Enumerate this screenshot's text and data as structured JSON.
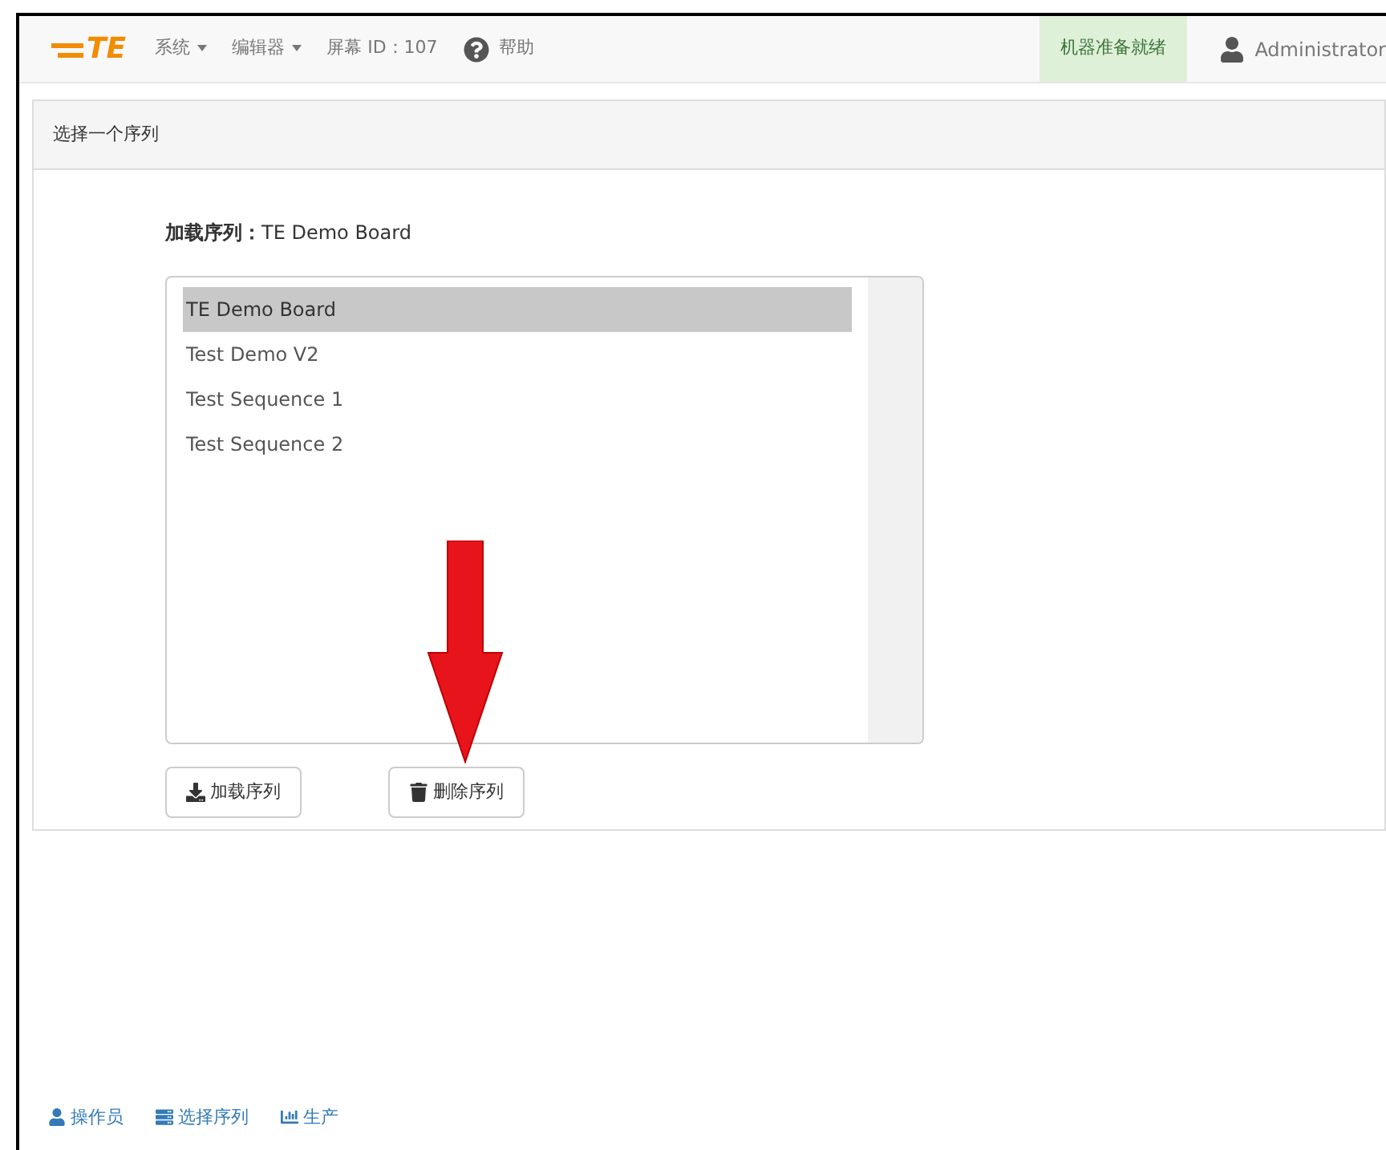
{
  "navbar": {
    "logo": "TE",
    "menus": [
      {
        "label": "系统",
        "caret": true
      },
      {
        "label": "编辑器",
        "caret": true
      },
      {
        "label": "屏幕 ID：107",
        "caret": false
      }
    ],
    "help": "帮助",
    "status": "机器准备就绪",
    "user": "Administrator"
  },
  "panel": {
    "title": "选择一个序列",
    "loaded_label": "加载序列：",
    "loaded_value": "TE Demo Board",
    "sequences": [
      {
        "label": "TE Demo Board",
        "selected": true
      },
      {
        "label": "Test Demo V2",
        "selected": false
      },
      {
        "label": "Test Sequence 1",
        "selected": false
      },
      {
        "label": "Test Sequence 2",
        "selected": false
      }
    ],
    "buttons": [
      {
        "kind": "load",
        "label": "加载序列"
      },
      {
        "kind": "delete",
        "label": "删除序列"
      }
    ]
  },
  "footer": [
    {
      "kind": "operator",
      "label": "操作员"
    },
    {
      "kind": "sequence",
      "label": "选择序列"
    },
    {
      "kind": "production",
      "label": "生产"
    }
  ]
}
